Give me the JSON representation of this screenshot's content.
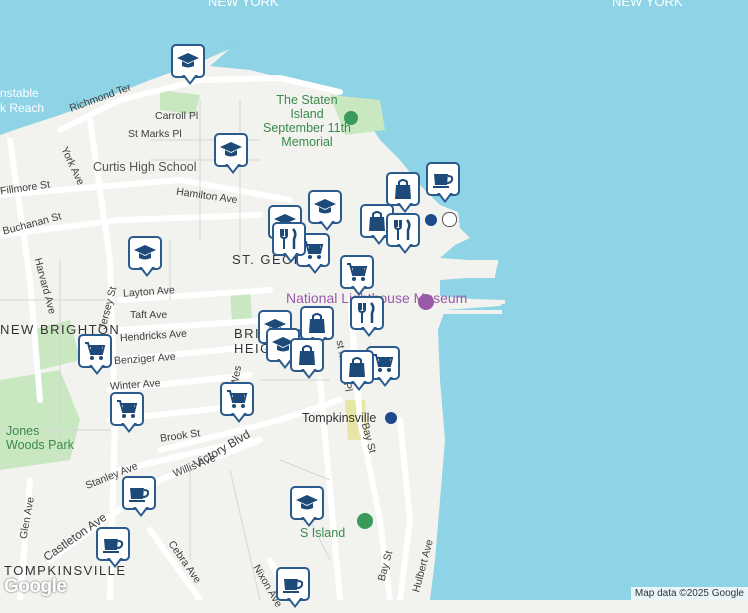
{
  "map": {
    "water_labels": [
      "NEW YORK",
      "NEW YORK"
    ],
    "street_labels": [
      "Richmond Ter",
      "Carroll Pl",
      "St Marks Pl",
      "Hamilton Ave",
      "Fillmore St",
      "Buchanan St",
      "York Ave",
      "Harvard Ave",
      "Layton Ave",
      "Taft Ave",
      "Hendricks Ave",
      "Benziger Ave",
      "Winter Ave",
      "Jersey St",
      "Brook St",
      "Victory Blvd",
      "Stanley Ave",
      "Willis Ave",
      "Glen Ave",
      "Castleton Ave",
      "Cebra Ave",
      "Bay St",
      "Nixon Ave",
      "Hulbert Ave",
      "Wes",
      "st Marks Pl"
    ],
    "area_labels": [
      "ST. GEORGE",
      "NEW BRIGHTON",
      "BRIGHTON HEIGHTS",
      "TOMPKINSVILLE"
    ],
    "poi_labels": {
      "memorial": "The Staten Island September 11th Memorial",
      "school": "Curtis High School",
      "museum": "National Lighthouse Museum",
      "park": "Jones Woods Park",
      "station": "Tompkinsville",
      "crumb": "Crum",
      "staten_island": "S Island",
      "stable": "nstable",
      "reach": "k Reach"
    },
    "markers": [
      {
        "icon": "school"
      },
      {
        "icon": "school"
      },
      {
        "icon": "school"
      },
      {
        "icon": "school"
      },
      {
        "icon": "school"
      },
      {
        "icon": "school"
      },
      {
        "icon": "school"
      },
      {
        "icon": "school"
      },
      {
        "icon": "cart"
      },
      {
        "icon": "cart"
      },
      {
        "icon": "cart"
      },
      {
        "icon": "cart"
      },
      {
        "icon": "cart"
      },
      {
        "icon": "cart"
      },
      {
        "icon": "bag"
      },
      {
        "icon": "bag"
      },
      {
        "icon": "bag"
      },
      {
        "icon": "bag"
      },
      {
        "icon": "bag"
      },
      {
        "icon": "cutlery"
      },
      {
        "icon": "cutlery"
      },
      {
        "icon": "cutlery"
      },
      {
        "icon": "coffee"
      },
      {
        "icon": "coffee"
      },
      {
        "icon": "coffee"
      },
      {
        "icon": "coffee"
      }
    ],
    "google_logo": "Google",
    "attribution": "Map data ©2025 Google",
    "colors": {
      "water": "#8ed3e6",
      "land": "#f2f2ef",
      "park": "#c9e8c1",
      "marker_border": "#2b5a8c",
      "marker_icon": "#1d4a78"
    }
  }
}
